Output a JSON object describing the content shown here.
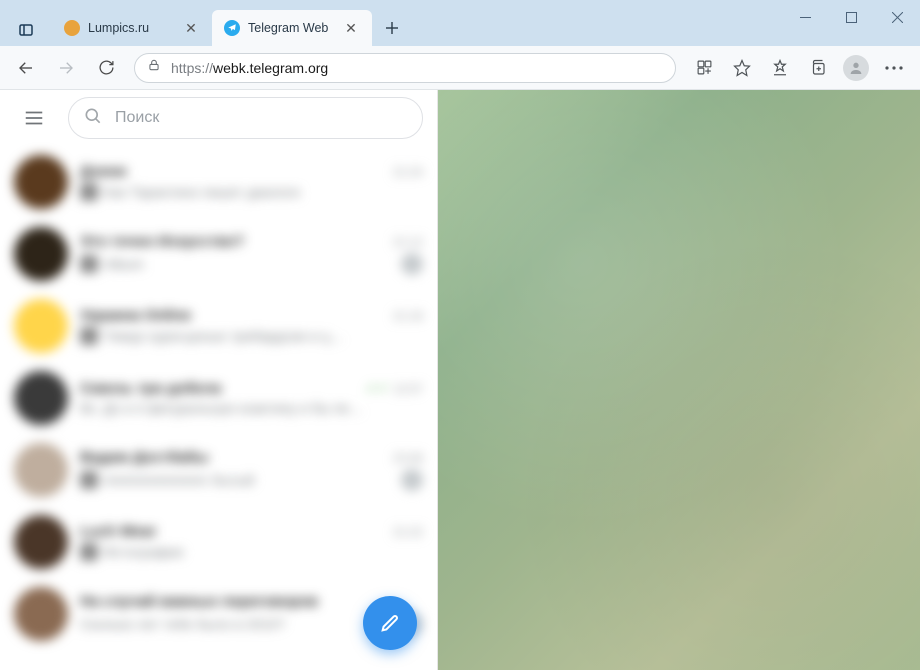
{
  "browser": {
    "tabs": [
      {
        "title": "Lumpics.ru",
        "active": false,
        "favicon_color": "#e8a33d"
      },
      {
        "title": "Telegram Web",
        "active": true,
        "favicon_color": "#2aabee"
      }
    ],
    "url_protocol": "https://",
    "url_host": "webk.telegram.org",
    "url_path": ""
  },
  "telegram": {
    "search_placeholder": "Поиск",
    "chats": [
      {
        "name": "Дэнни",
        "time": "21:24",
        "msg": "Как Тарантино пишет диалоги",
        "avatar": "#5a3a1e",
        "thumb": true,
        "badge": null
      },
      {
        "name": "Это точно Искусство?",
        "time": "21:12",
        "msg": "Album",
        "avatar": "#2d2418",
        "thumb": true,
        "badge": ""
      },
      {
        "name": "Украина Online",
        "time": "21:18",
        "msg": "Тимур оуресценые трибардсии и ц…",
        "avatar": "#ffd54a",
        "thumb": true,
        "badge": null
      },
      {
        "name": "Сквозь три добела",
        "time": "12:57",
        "msg": "Вк. До и я фигуральную коактину и бы пе…",
        "avatar": "#3a3a3a",
        "thumb": false,
        "badge": null,
        "sent": true
      },
      {
        "name": "Вадим Достбабы",
        "time": "23:48",
        "msg": "ААААААААААА Лытый",
        "avatar": "#bfae9e",
        "thumb": true,
        "badge": ""
      },
      {
        "name": "Luch Wear",
        "time": "21:22",
        "msg": "Фстография",
        "avatar": "#4a3628",
        "thumb": true,
        "badge": null
      },
      {
        "name": "На случай важных переговоров",
        "time": "",
        "msg": "Сколько лет тебе было в 2010?",
        "avatar": "#8a6a52",
        "thumb": false,
        "badge": "12"
      }
    ]
  }
}
